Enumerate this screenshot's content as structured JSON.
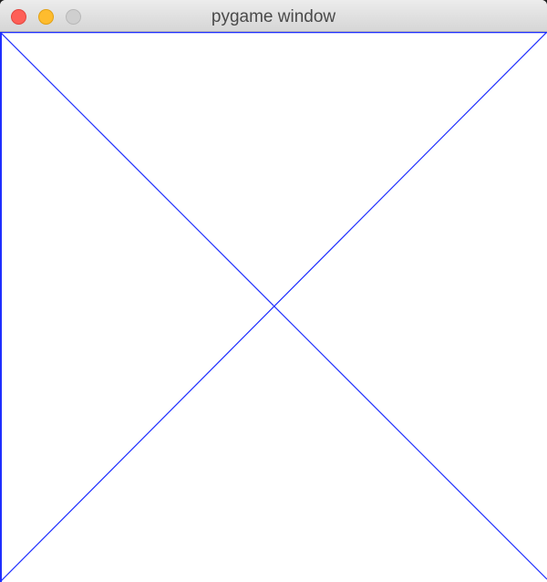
{
  "window": {
    "title": "pygame window"
  },
  "canvas": {
    "background_color": "#ffffff",
    "line_color": "#1f2fff",
    "shapes": [
      "rectangle-outline",
      "diagonal-line-top-left-to-bottom-right",
      "diagonal-line-top-right-to-bottom-left"
    ]
  },
  "icons": {
    "close": "close-icon",
    "minimize": "minimize-icon",
    "zoom": "zoom-icon"
  }
}
